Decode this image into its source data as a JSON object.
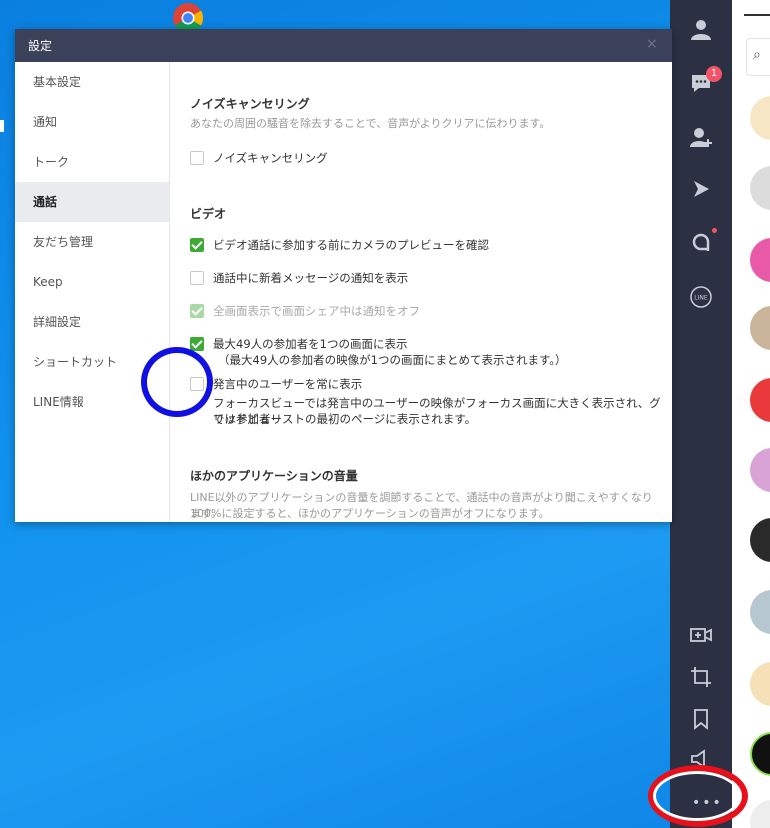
{
  "dialog": {
    "title": "設定",
    "close_glyph": "×"
  },
  "nav": {
    "items": [
      {
        "label": "基本設定"
      },
      {
        "label": "通知"
      },
      {
        "label": "トーク"
      },
      {
        "label": "通話"
      },
      {
        "label": "友だち管理"
      },
      {
        "label": "Keep"
      },
      {
        "label": "詳細設定"
      },
      {
        "label": "ショートカット"
      },
      {
        "label": "LINE情報"
      }
    ],
    "active": "通話"
  },
  "noise": {
    "title": "ノイズキャンセリング",
    "desc": "あなたの周囲の騒音を除去することで、音声がよりクリアに伝わります。",
    "option": {
      "label": "ノイズキャンセリング",
      "checked": false
    }
  },
  "video": {
    "title": "ビデオ",
    "options": [
      {
        "label": "ビデオ通話に参加する前にカメラのプレビューを確認",
        "checked": true
      },
      {
        "label": "通話中に新着メッセージの通知を表示",
        "checked": false
      },
      {
        "label": "全画面表示で画面シェア中は通知をオフ",
        "checked": true,
        "disabled": true
      },
      {
        "label": "最大49人の参加者を1つの画面に表示",
        "sub": "（最大49人の参加者の映像が1つの画面にまとめて表示されます。）",
        "checked": true
      },
      {
        "label": "発言中のユーザーを常に表示",
        "sub1": "フォーカスビューでは発言中のユーザーの映像がフォーカス画面に大きく表示され、グリッドビュー",
        "sub2": "では参加者リストの最初のページに表示されます。",
        "checked": false
      }
    ]
  },
  "other_apps": {
    "title": "ほかのアプリケーションの音量",
    "desc1": "LINE以外のアプリケーションの音量を調節することで、通話中の音声がより聞こえやすくなります。",
    "desc2": "100%に設定すると、ほかのアプリケーションの音声がオフになります。"
  },
  "sidebar": {
    "badge": "1",
    "more": "•••",
    "icons": [
      "person-icon",
      "chat-icon",
      "add-friend-icon",
      "voom-icon",
      "openchat-icon",
      "line-icon",
      "video-add-icon",
      "crop-icon",
      "bookmark-icon",
      "speaker-icon",
      "more-icon"
    ]
  },
  "colors": {
    "checkbox_green": "#3daa36",
    "titlebar": "#3b4159",
    "sidebar": "#2b3143",
    "annotation_blue": "#1010e0",
    "annotation_red": "#e8101a"
  }
}
